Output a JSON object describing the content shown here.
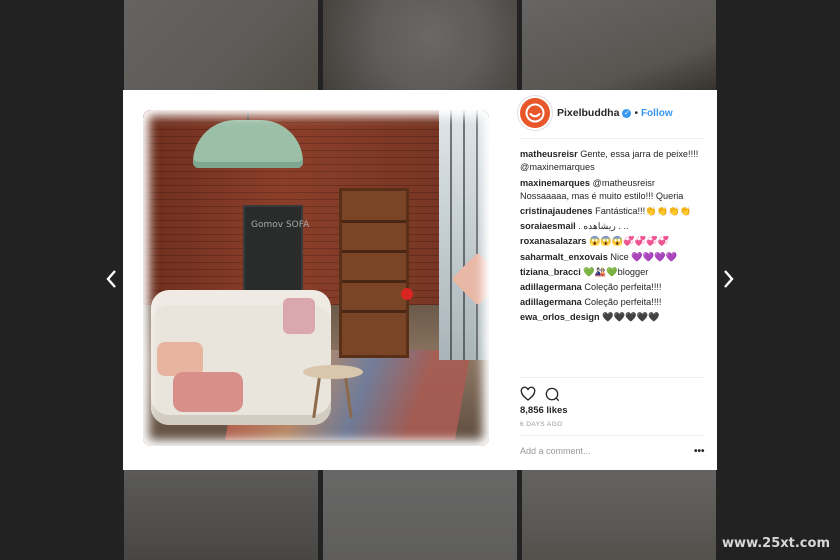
{
  "account": {
    "username": "Pixelbuddha",
    "follow_label": "Follow",
    "separator": "•"
  },
  "comments": [
    {
      "user": "matheusreisr",
      "text": "Gente, essa jarra de peixe!!!!",
      "mention": "@maxinemarques"
    },
    {
      "user": "maxinemarques",
      "text": "@matheusreisr Nossaaaaa, mas é muito estilo!!! Queria"
    },
    {
      "user": "cristinajaudenes",
      "text": "Fantástica!!!👏👏👏👏"
    },
    {
      "user": "soraiaesmail",
      "text": ". ريشاهده . .."
    },
    {
      "user": "roxanasalazars",
      "text": "😱😱😱💞💞💞💞"
    },
    {
      "user": "saharmalt_enxovais",
      "text": "Nice 💜💜💜💜"
    },
    {
      "user": "tiziana_bracci",
      "text": "💚🎎💚blogger"
    },
    {
      "user": "adillagermana",
      "text": "Coleção perfeita!!!!"
    },
    {
      "user": "adillagermana",
      "text": "Coleção perfeita!!!!"
    },
    {
      "user": "ewa_orlos_design",
      "text": "🖤🖤🖤🖤🖤"
    }
  ],
  "stats": {
    "likes": "8,856 likes",
    "posted": "6 DAYS AGO"
  },
  "composer": {
    "placeholder": "Add a comment...",
    "more": "•••"
  },
  "photo": {
    "board_text": "Gomov SOFA"
  },
  "watermark": "www.25xt.com",
  "colors": {
    "accent": "#3897f0",
    "avatar": "#e8572a",
    "text": "#262626",
    "muted": "#999999"
  }
}
